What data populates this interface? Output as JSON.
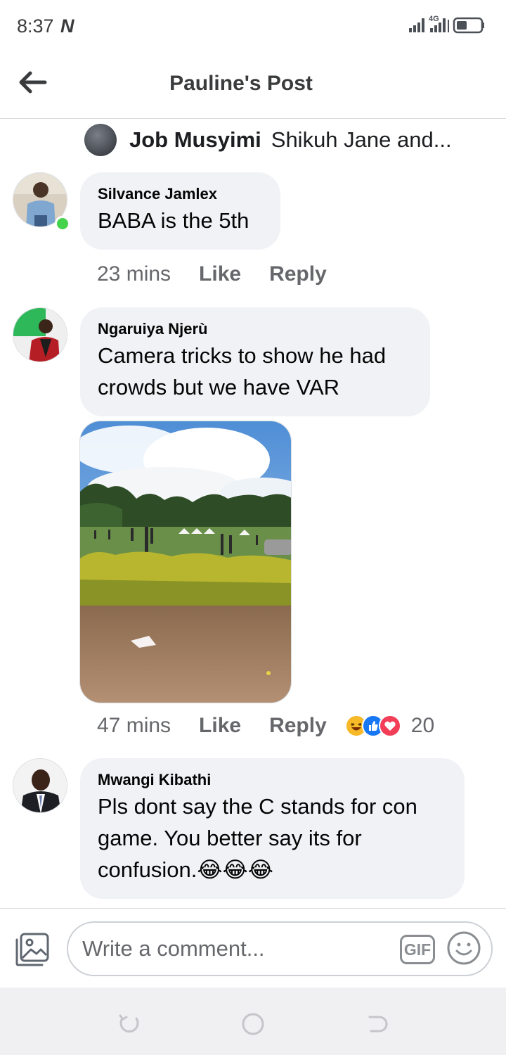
{
  "status_bar": {
    "time": "8:37",
    "network_badge": "N",
    "icons": [
      "signal-icon",
      "4g-signal-icon",
      "battery-icon"
    ]
  },
  "header": {
    "title": "Pauline's Post",
    "back_icon": "arrow-left-icon"
  },
  "reactors": {
    "name": "Job Musyimi",
    "others": "Shikuh Jane and..."
  },
  "comments": [
    {
      "author": "Silvance Jamlex",
      "text": "BABA is the 5th",
      "time": "23 mins",
      "like_label": "Like",
      "reply_label": "Reply",
      "online": true
    },
    {
      "author": "Ngaruiya Njerù",
      "text_lines": [
        "Camera tricks to show he had",
        "crowds but we have VAR"
      ],
      "time": "47 mins",
      "like_label": "Like",
      "reply_label": "Reply",
      "reaction_count": "20",
      "reaction_icons": [
        "haha-icon",
        "like-icon",
        "love-icon"
      ],
      "has_photo": true
    },
    {
      "author": "Mwangi Kibathi",
      "text_lines": [
        "Pls dont say the C stands for con",
        "game. You better say its for",
        "confusion.😂😂😂"
      ]
    }
  ],
  "composer": {
    "placeholder": "Write a comment...",
    "gif_label": "GIF"
  },
  "colors": {
    "bubble": "#f0f2f5",
    "meta_text": "#65676b",
    "online": "#44d34b"
  }
}
